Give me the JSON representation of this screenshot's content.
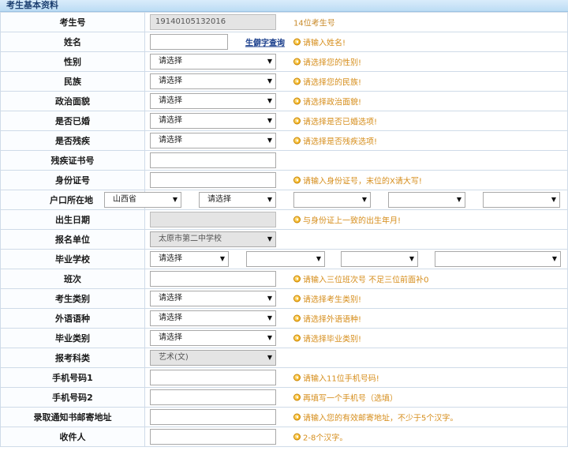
{
  "section_title": "考生基本资料",
  "placeholders": {
    "select": "请选择"
  },
  "rows": {
    "exam_no": {
      "label": "考生号",
      "value": "19140105132016",
      "hint": "14位考生号"
    },
    "name": {
      "label": "姓名",
      "value": "",
      "link": "生僻字查询",
      "hint": "请输入姓名!"
    },
    "gender": {
      "label": "性别",
      "value": "请选择",
      "hint": "请选择您的性别!"
    },
    "ethnicity": {
      "label": "民族",
      "value": "请选择",
      "hint": "请选择您的民族!"
    },
    "political": {
      "label": "政治面貌",
      "value": "请选择",
      "hint": "请选择政治面貌!"
    },
    "married": {
      "label": "是否已婚",
      "value": "请选择",
      "hint": "请选择是否已婚选项!"
    },
    "disabled": {
      "label": "是否残疾",
      "value": "请选择",
      "hint": "请选择是否残疾选项!"
    },
    "disability_cert": {
      "label": "残疾证书号",
      "value": ""
    },
    "id_no": {
      "label": "身份证号",
      "value": "",
      "hint": "请输入身份证号，末位的X请大写!"
    },
    "hukou": {
      "label": "户口所在地",
      "province": "山西省",
      "city": "请选择",
      "district": "",
      "town": "",
      "village": ""
    },
    "birth": {
      "label": "出生日期",
      "value": "",
      "hint": "与身份证上一致的出生年月!"
    },
    "unit": {
      "label": "报名单位",
      "value": "太原市第二中学校"
    },
    "school": {
      "label": "毕业学校",
      "v1": "请选择",
      "v2": "",
      "v3": "",
      "v4": ""
    },
    "class_no": {
      "label": "班次",
      "value": "",
      "hint": "请输入三位班次号 不足三位前面补0"
    },
    "category": {
      "label": "考生类别",
      "value": "请选择",
      "hint": "请选择考生类别!"
    },
    "language": {
      "label": "外语语种",
      "value": "请选择",
      "hint": "请选择外语语种!"
    },
    "grad_type": {
      "label": "毕业类别",
      "value": "请选择",
      "hint": "请选择毕业类别!"
    },
    "subject": {
      "label": "报考科类",
      "value": "艺术(文)"
    },
    "phone1": {
      "label": "手机号码1",
      "value": "",
      "hint": "请输入11位手机号码!"
    },
    "phone2": {
      "label": "手机号码2",
      "value": "",
      "hint": "再填写一个手机号（选填）"
    },
    "address": {
      "label": "录取通知书邮寄地址",
      "value": "",
      "hint": "请输入您的有效邮寄地址，不少于5个汉字。"
    },
    "recipient": {
      "label": "收件人",
      "value": "",
      "hint": "2-8个汉字。"
    }
  }
}
